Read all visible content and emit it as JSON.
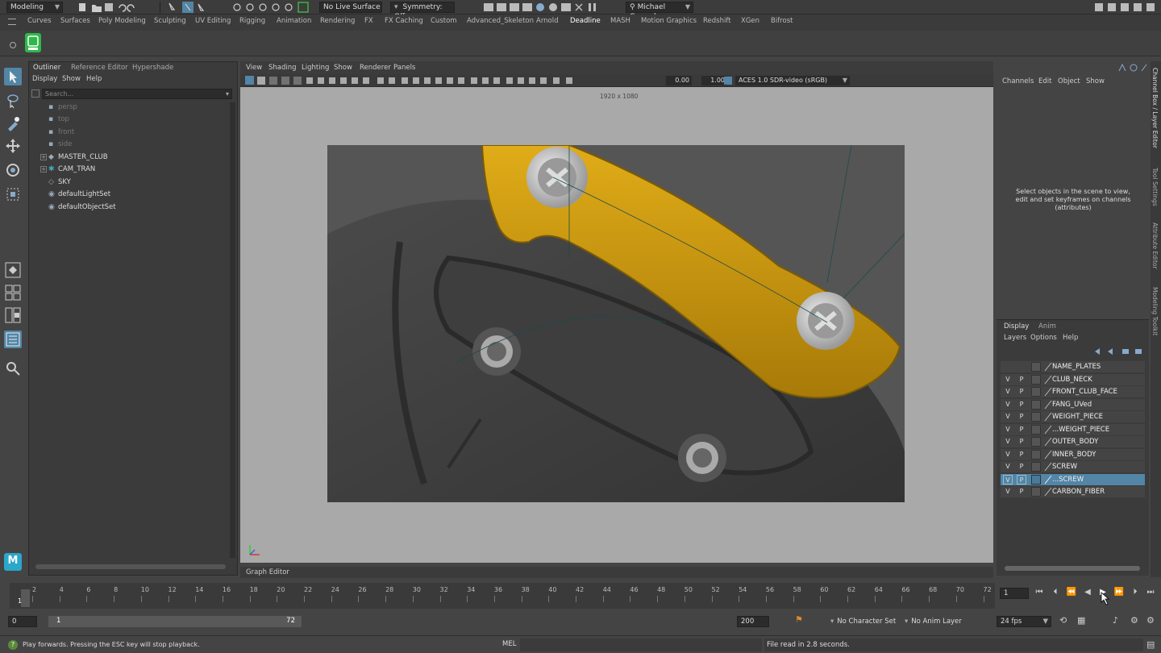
{
  "statusline": {
    "mode": "Modeling",
    "live_surface": "No Live Surface",
    "symmetry": "Symmetry: Off",
    "user": "Michael Conrad"
  },
  "shelf": {
    "tabs": [
      "Curves",
      "Surfaces",
      "Poly Modeling",
      "Sculpting",
      "UV Editing",
      "Rigging",
      "Animation",
      "Rendering",
      "FX",
      "FX Caching",
      "Custom",
      "Advanced_Skeleton",
      "Arnold",
      "Deadline",
      "MASH",
      "Motion Graphics",
      "Redshift",
      "XGen",
      "Bifrost"
    ],
    "active": "Deadline"
  },
  "outliner": {
    "tabs": [
      "Outliner",
      "Reference Editor",
      "Hypershade"
    ],
    "menu": [
      "Display",
      "Show",
      "Help"
    ],
    "search_placeholder": "Search...",
    "items": [
      {
        "label": "persp",
        "icon": "camera-icon",
        "dim": true
      },
      {
        "label": "top",
        "icon": "camera-icon",
        "dim": true
      },
      {
        "label": "front",
        "icon": "camera-icon",
        "dim": true
      },
      {
        "label": "side",
        "icon": "camera-icon",
        "dim": true
      },
      {
        "label": "MASTER_CLUB",
        "icon": "group-icon",
        "dim": false,
        "expandable": true
      },
      {
        "label": "CAM_TRAN",
        "icon": "transform-icon",
        "dim": false,
        "expandable": true
      },
      {
        "label": "SKY",
        "icon": "light-icon",
        "dim": false
      },
      {
        "label": "defaultLightSet",
        "icon": "set-icon",
        "dim": false
      },
      {
        "label": "defaultObjectSet",
        "icon": "set-icon",
        "dim": false
      }
    ]
  },
  "viewport": {
    "menu": [
      "View",
      "Shading",
      "Lighting",
      "Show",
      "Renderer",
      "Panels"
    ],
    "exposure": "0.00",
    "gamma": "1.00",
    "color_space": "ACES 1.0 SDR-video (sRGB)",
    "resolution_label": "1920 x 1080"
  },
  "graph_editor_label": "Graph Editor",
  "channel_box": {
    "menu": [
      "Channels",
      "Edit",
      "Object",
      "Show"
    ],
    "message": "Select objects in the scene to view, edit and set keyframes on channels (attributes)"
  },
  "side_tabs": [
    "Channel Box / Layer Editor",
    "Tool Settings",
    "Attribute Editor",
    "Modeling Toolkit"
  ],
  "layer_editor": {
    "tabs": [
      "Display",
      "Anim"
    ],
    "menu": [
      "Layers",
      "Options",
      "Help"
    ],
    "layers": [
      {
        "name": "NAME_PLATES",
        "v": "",
        "p": "",
        "selected": false
      },
      {
        "name": "CLUB_NECK",
        "v": "V",
        "p": "P",
        "selected": false
      },
      {
        "name": "FRONT_CLUB_FACE",
        "v": "V",
        "p": "P",
        "selected": false
      },
      {
        "name": "FANG_UVed",
        "v": "V",
        "p": "P",
        "selected": false
      },
      {
        "name": "WEIGHT_PIECE",
        "v": "V",
        "p": "P",
        "selected": false
      },
      {
        "name": "...WEIGHT_PIECE",
        "v": "V",
        "p": "P",
        "selected": false
      },
      {
        "name": "OUTER_BODY",
        "v": "V",
        "p": "P",
        "selected": false
      },
      {
        "name": "INNER_BODY",
        "v": "V",
        "p": "P",
        "selected": false
      },
      {
        "name": "SCREW",
        "v": "V",
        "p": "P",
        "selected": false
      },
      {
        "name": "...SCREW",
        "v": "V",
        "p": "P",
        "selected": true
      },
      {
        "name": "CARBON_FIBER",
        "v": "V",
        "p": "P",
        "selected": false
      }
    ]
  },
  "timeline": {
    "ticks": [
      "2",
      "4",
      "6",
      "8",
      "10",
      "12",
      "14",
      "16",
      "18",
      "20",
      "22",
      "24",
      "26",
      "28",
      "30",
      "32",
      "34",
      "36",
      "38",
      "40",
      "42",
      "44",
      "46",
      "48",
      "50",
      "52",
      "54",
      "56",
      "58",
      "60",
      "62",
      "64",
      "66",
      "68",
      "70",
      "72"
    ],
    "current_frame": "1",
    "current_frame_field": "1"
  },
  "range": {
    "start": "0",
    "range_start": "1",
    "range_end": "72",
    "end": "200",
    "character_set": "No Character Set",
    "anim_layer": "No Anim Layer",
    "fps": "24 fps"
  },
  "command_line": {
    "help_text": "Play forwards. Pressing the ESC key will stop playback.",
    "lang": "MEL",
    "result": "File read in  2.8 seconds."
  },
  "colors": {
    "accent": "#5285a6",
    "club_yellow": "#c9960e",
    "club_body": "#3a3a3a"
  }
}
